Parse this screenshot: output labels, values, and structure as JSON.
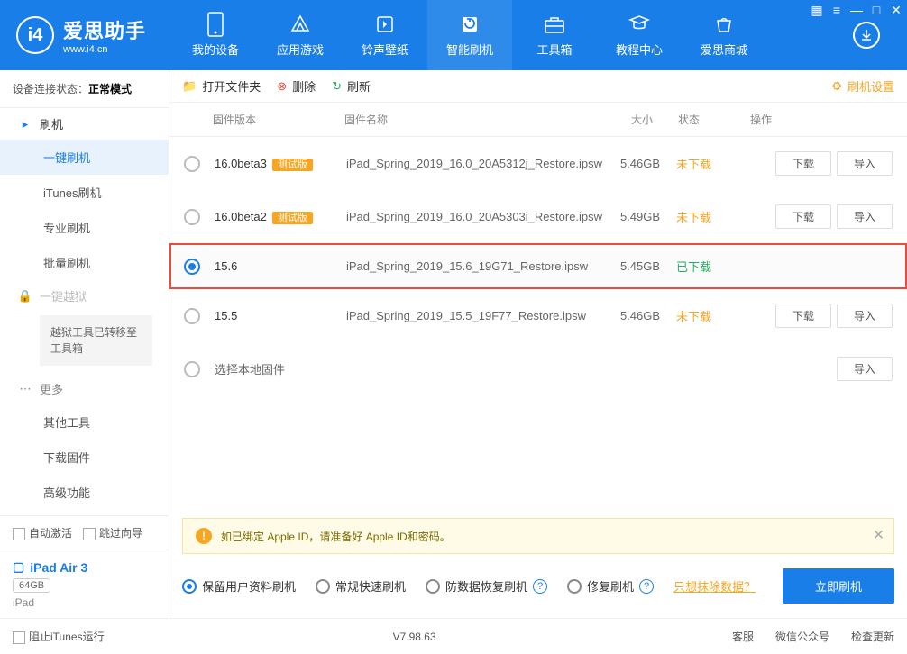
{
  "logo": {
    "name": "爱思助手",
    "sub": "www.i4.cn"
  },
  "nav": [
    {
      "label": "我的设备"
    },
    {
      "label": "应用游戏"
    },
    {
      "label": "铃声壁纸"
    },
    {
      "label": "智能刷机"
    },
    {
      "label": "工具箱"
    },
    {
      "label": "教程中心"
    },
    {
      "label": "爱思商城"
    }
  ],
  "conn_status": {
    "prefix": "设备连接状态：",
    "value": "正常模式"
  },
  "sidebar": {
    "group_flash": "刷机",
    "items_flash": [
      "一键刷机",
      "iTunes刷机",
      "专业刷机",
      "批量刷机"
    ],
    "group_jailbreak": "一键越狱",
    "jb_note": "越狱工具已转移至工具箱",
    "group_more": "更多",
    "items_more": [
      "其他工具",
      "下载固件",
      "高级功能"
    ]
  },
  "side_foot": {
    "auto": "自动激活",
    "skip": "跳过向导"
  },
  "device": {
    "name": "iPad Air 3",
    "storage": "64GB",
    "type": "iPad"
  },
  "toolbar": {
    "open": "打开文件夹",
    "delete": "删除",
    "refresh": "刷新",
    "settings": "刷机设置"
  },
  "table": {
    "headers": {
      "version": "固件版本",
      "name": "固件名称",
      "size": "大小",
      "status": "状态",
      "actions": "操作"
    },
    "rows": [
      {
        "version": "16.0beta3",
        "beta": "测试版",
        "name": "iPad_Spring_2019_16.0_20A5312j_Restore.ipsw",
        "size": "5.46GB",
        "status": "未下载",
        "st_cls": "status-orange",
        "dl": true
      },
      {
        "version": "16.0beta2",
        "beta": "测试版",
        "name": "iPad_Spring_2019_16.0_20A5303i_Restore.ipsw",
        "size": "5.49GB",
        "status": "未下载",
        "st_cls": "status-orange",
        "dl": true
      },
      {
        "version": "15.6",
        "beta": "",
        "name": "iPad_Spring_2019_15.6_19G71_Restore.ipsw",
        "size": "5.45GB",
        "status": "已下载",
        "st_cls": "status-green",
        "dl": false,
        "selected": true
      },
      {
        "version": "15.5",
        "beta": "",
        "name": "iPad_Spring_2019_15.5_19F77_Restore.ipsw",
        "size": "5.46GB",
        "status": "未下载",
        "st_cls": "status-orange",
        "dl": true
      }
    ],
    "local_row": "选择本地固件",
    "btn_download": "下载",
    "btn_import": "导入"
  },
  "alert": "如已绑定 Apple ID，请准备好 Apple ID和密码。",
  "options": {
    "o1": "保留用户资料刷机",
    "o2": "常规快速刷机",
    "o3": "防数据恢复刷机",
    "o4": "修复刷机",
    "link": "只想抹除数据？",
    "flash": "立即刷机"
  },
  "footer": {
    "block_itunes": "阻止iTunes运行",
    "version": "V7.98.63",
    "links": [
      "客服",
      "微信公众号",
      "检查更新"
    ]
  }
}
